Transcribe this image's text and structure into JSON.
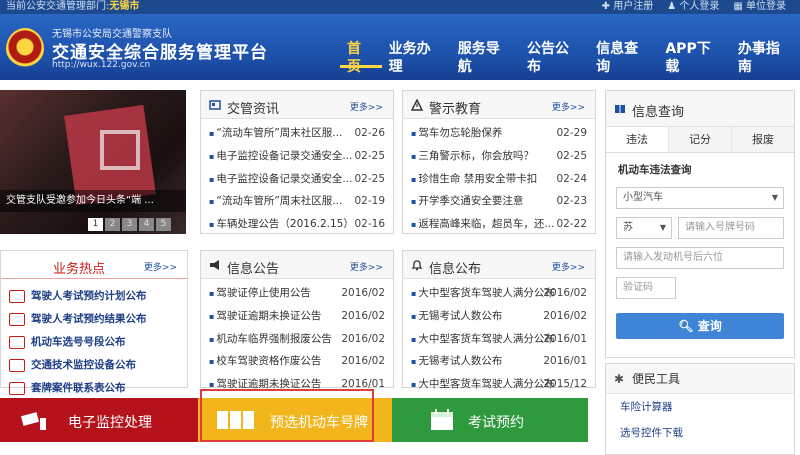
{
  "topbar": {
    "dept_label": "当前公安交通管理部门:",
    "dept_value": "无锡市",
    "links": [
      "用户注册",
      "个人登录",
      "单位登录"
    ]
  },
  "header": {
    "subtitle": "无锡市公安局交通警察支队",
    "title": "交通安全综合服务管理平台",
    "url": "http://wux.122.gov.cn",
    "nav": [
      "首页",
      "业务办理",
      "服务导航",
      "公告公布",
      "信息查询",
      "APP下载",
      "办事指南"
    ],
    "nav_active": 0
  },
  "slider": {
    "caption": "交管支队受邀参加今日头条“端 ...",
    "pages": [
      "1",
      "2",
      "3",
      "4",
      "5"
    ],
    "current": 0
  },
  "news": {
    "title": "交管资讯",
    "more": "更多>>",
    "items": [
      {
        "t": "“流动车管所”周末社区服...",
        "d": "02-26"
      },
      {
        "t": "电子监控设备记录交通安全...",
        "d": "02-25"
      },
      {
        "t": "电子监控设备记录交通安全...",
        "d": "02-25"
      },
      {
        "t": "“流动车管所”周末社区服...",
        "d": "02-19"
      },
      {
        "t": "车辆处理公告（2016.2.15）",
        "d": "02-16"
      }
    ]
  },
  "warn": {
    "title": "警示教育",
    "more": "更多>>",
    "items": [
      {
        "t": "驾车勿忘轮胎保养",
        "d": "02-29"
      },
      {
        "t": "三角警示标，你会放吗？",
        "d": "02-25"
      },
      {
        "t": "珍惜生命 禁用安全带卡扣",
        "d": "02-24"
      },
      {
        "t": "开学季交通安全要注意",
        "d": "02-23"
      },
      {
        "t": "返程高峰来临，超员车，还...",
        "d": "02-22"
      }
    ]
  },
  "hot": {
    "title": "业务热点",
    "more": "更多>>",
    "items": [
      "驾驶人考试预约计划公布",
      "驾驶人考试预约结果公布",
      "机动车选号号段公布",
      "交通技术监控设备公布",
      "套牌案件联系表公布"
    ]
  },
  "notice": {
    "title": "信息公告",
    "more": "更多>>",
    "items": [
      {
        "t": "驾驶证停止使用公告",
        "d": "2016/02"
      },
      {
        "t": "驾驶证逾期未换证公告",
        "d": "2016/02"
      },
      {
        "t": "机动车临界强制报废公告",
        "d": "2016/02"
      },
      {
        "t": "校车驾驶资格作废公告",
        "d": "2016/02"
      },
      {
        "t": "驾驶证逾期未换证公告",
        "d": "2016/01"
      }
    ]
  },
  "publish": {
    "title": "信息公布",
    "more": "更多>>",
    "items": [
      {
        "t": "大中型客货车驾驶人满分公布",
        "d": "2016/02"
      },
      {
        "t": "无锡考试人数公布",
        "d": "2016/02"
      },
      {
        "t": "大中型客货车驾驶人满分公布",
        "d": "2016/01"
      },
      {
        "t": "无锡考试人数公布",
        "d": "2016/01"
      },
      {
        "t": "大中型客货车驾驶人满分公布",
        "d": "2015/12"
      }
    ]
  },
  "query": {
    "title": "信息查询",
    "tabs": [
      "违法",
      "记分",
      "报废"
    ],
    "active_tab": 0,
    "label": "机动车违法查询",
    "vehicle_type": "小型汽车",
    "province": "苏",
    "plate_placeholder": "请输入号牌号码",
    "engine_placeholder": "请输入发动机号后六位",
    "captcha_placeholder": "验证码",
    "button": "查询"
  },
  "convenience": {
    "title": "便民工具",
    "items": [
      "车险计算器",
      "选号控件下载"
    ]
  },
  "bottom": [
    {
      "label": "电子监控处理",
      "color": "#b5121b"
    },
    {
      "label": "预选机动车号牌",
      "color": "#f2b51c"
    },
    {
      "label": "考试预约",
      "color": "#2f9a3d"
    }
  ]
}
